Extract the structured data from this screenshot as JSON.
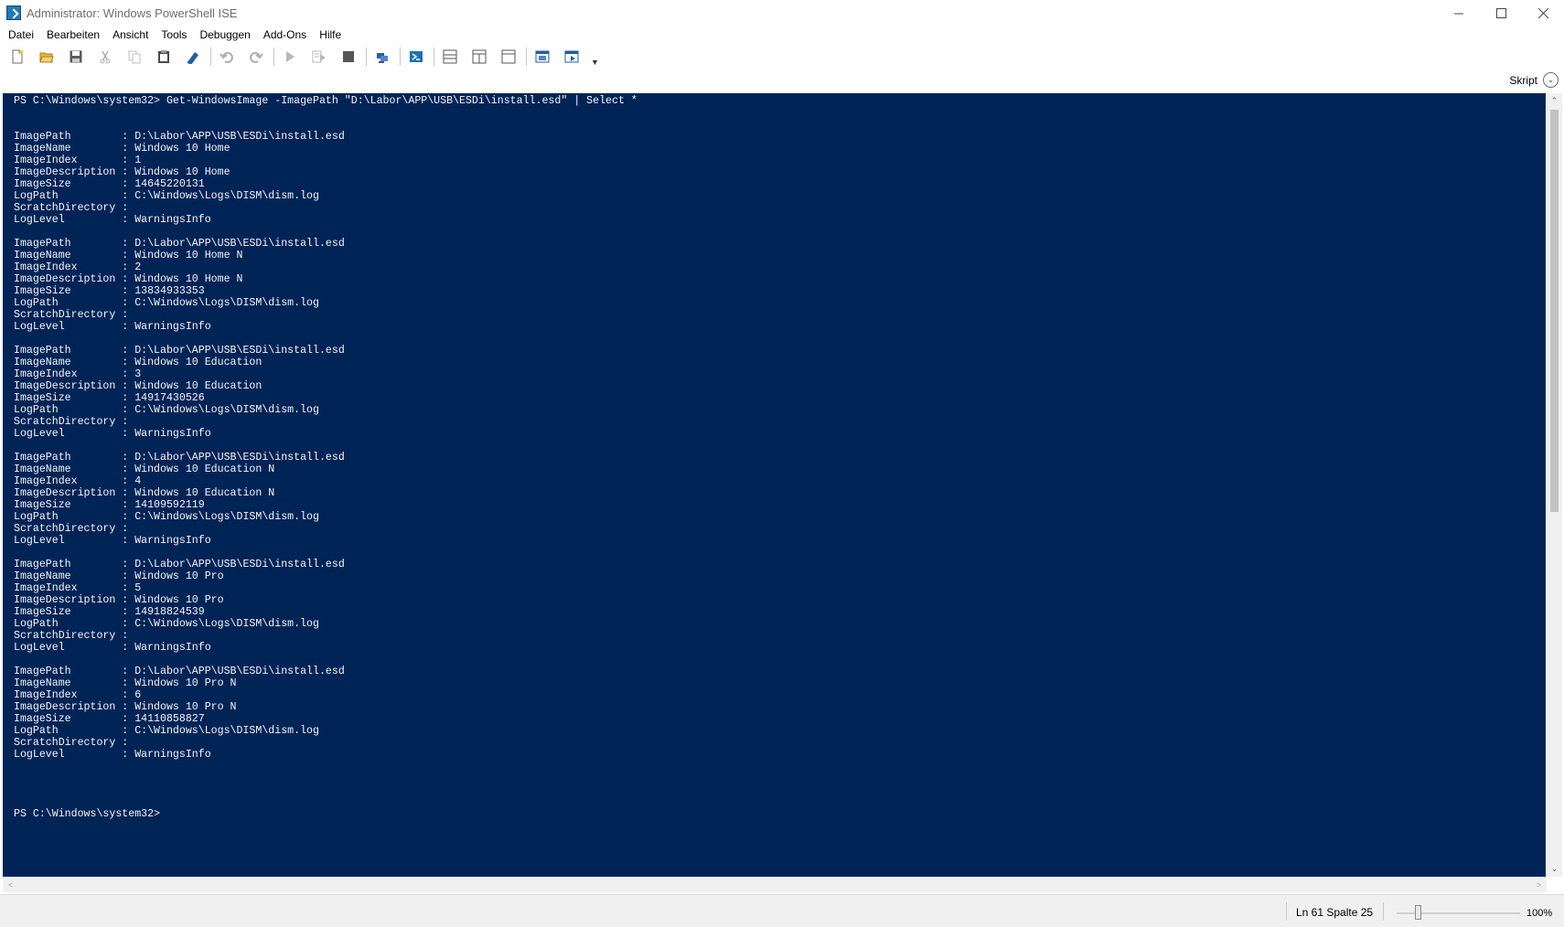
{
  "window": {
    "title": "Administrator: Windows PowerShell ISE",
    "controls": [
      "minimize-icon",
      "maximize-icon",
      "close-icon"
    ]
  },
  "menu": {
    "items": [
      "Datei",
      "Bearbeiten",
      "Ansicht",
      "Tools",
      "Debuggen",
      "Add-Ons",
      "Hilfe"
    ]
  },
  "toolbar": {
    "buttons": [
      "new-file-icon",
      "open-file-icon",
      "save-icon",
      "cut-icon",
      "copy-icon",
      "paste-icon",
      "clear-console-icon",
      "undo-icon",
      "redo-icon",
      "run-script-icon",
      "run-selection-icon",
      "stop-icon",
      "new-remote-tab-icon",
      "start-powershell-icon",
      "show-script-top-icon",
      "show-script-right-icon",
      "show-script-maximized-icon",
      "show-command-window-icon",
      "show-command-addon-icon"
    ]
  },
  "script_toggle": {
    "label": "Skript"
  },
  "console": {
    "lines": [
      "PS C:\\Windows\\system32> Get-WindowsImage -ImagePath \"D:\\Labor\\APP\\USB\\ESDi\\install.esd\" | Select *",
      "",
      "",
      "ImagePath        : D:\\Labor\\APP\\USB\\ESDi\\install.esd",
      "ImageName        : Windows 10 Home",
      "ImageIndex       : 1",
      "ImageDescription : Windows 10 Home",
      "ImageSize        : 14645220131",
      "LogPath          : C:\\Windows\\Logs\\DISM\\dism.log",
      "ScratchDirectory :",
      "LogLevel         : WarningsInfo",
      "",
      "ImagePath        : D:\\Labor\\APP\\USB\\ESDi\\install.esd",
      "ImageName        : Windows 10 Home N",
      "ImageIndex       : 2",
      "ImageDescription : Windows 10 Home N",
      "ImageSize        : 13834933353",
      "LogPath          : C:\\Windows\\Logs\\DISM\\dism.log",
      "ScratchDirectory :",
      "LogLevel         : WarningsInfo",
      "",
      "ImagePath        : D:\\Labor\\APP\\USB\\ESDi\\install.esd",
      "ImageName        : Windows 10 Education",
      "ImageIndex       : 3",
      "ImageDescription : Windows 10 Education",
      "ImageSize        : 14917430526",
      "LogPath          : C:\\Windows\\Logs\\DISM\\dism.log",
      "ScratchDirectory :",
      "LogLevel         : WarningsInfo",
      "",
      "ImagePath        : D:\\Labor\\APP\\USB\\ESDi\\install.esd",
      "ImageName        : Windows 10 Education N",
      "ImageIndex       : 4",
      "ImageDescription : Windows 10 Education N",
      "ImageSize        : 14109592119",
      "LogPath          : C:\\Windows\\Logs\\DISM\\dism.log",
      "ScratchDirectory :",
      "LogLevel         : WarningsInfo",
      "",
      "ImagePath        : D:\\Labor\\APP\\USB\\ESDi\\install.esd",
      "ImageName        : Windows 10 Pro",
      "ImageIndex       : 5",
      "ImageDescription : Windows 10 Pro",
      "ImageSize        : 14918824539",
      "LogPath          : C:\\Windows\\Logs\\DISM\\dism.log",
      "ScratchDirectory :",
      "LogLevel         : WarningsInfo",
      "",
      "ImagePath        : D:\\Labor\\APP\\USB\\ESDi\\install.esd",
      "ImageName        : Windows 10 Pro N",
      "ImageIndex       : 6",
      "ImageDescription : Windows 10 Pro N",
      "ImageSize        : 14110858827",
      "LogPath          : C:\\Windows\\Logs\\DISM\\dism.log",
      "ScratchDirectory :",
      "LogLevel         : WarningsInfo",
      "",
      "",
      "",
      "",
      "PS C:\\Windows\\system32>"
    ],
    "background": "#012456",
    "foreground": "#F5F5F5"
  },
  "status": {
    "position": "Ln 61  Spalte 25",
    "zoom": "100%",
    "zoom_fraction": 0.15
  }
}
